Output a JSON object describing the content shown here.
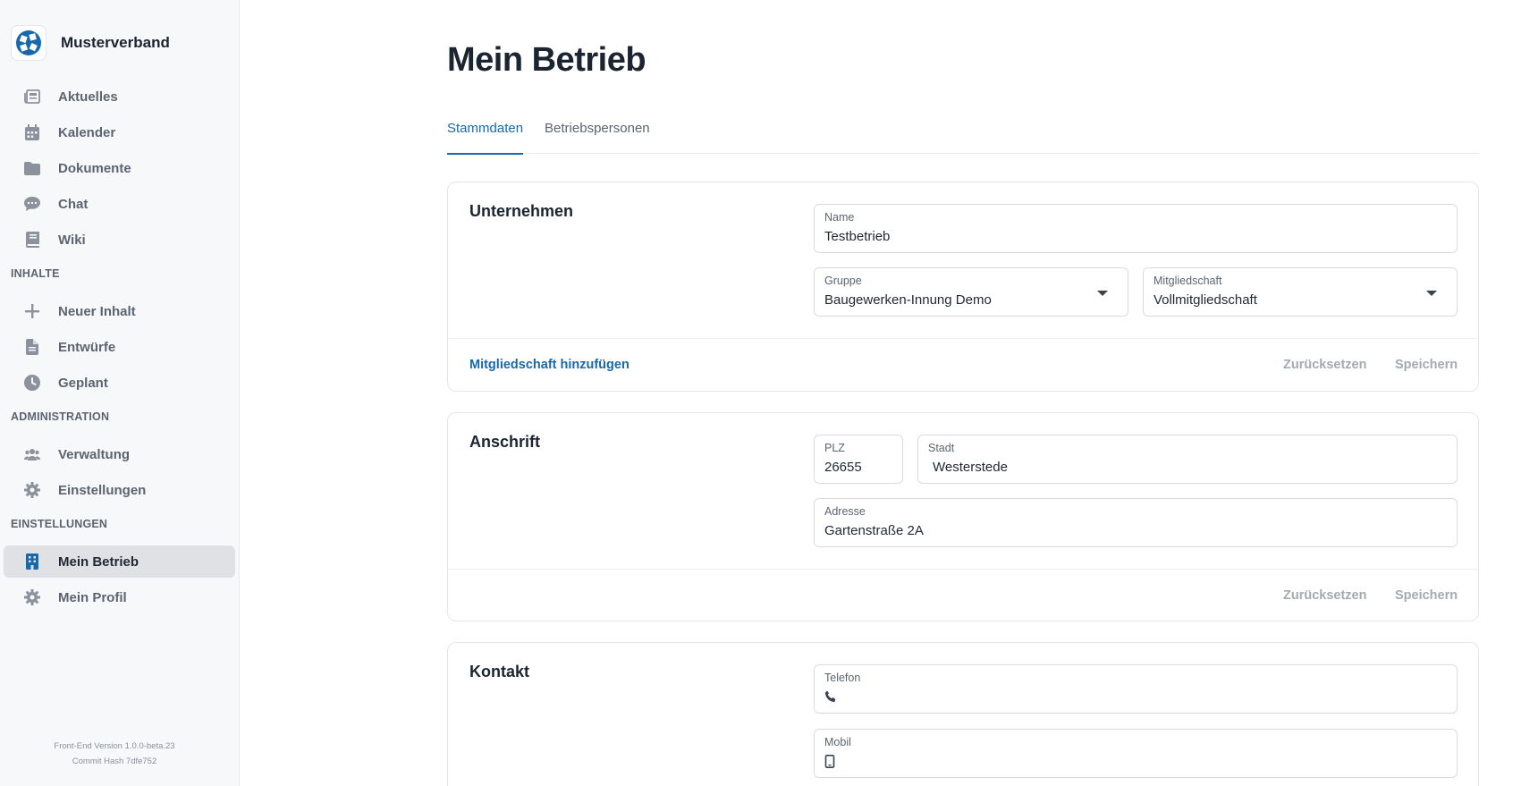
{
  "brand": {
    "name": "Musterverband"
  },
  "sidebar": {
    "main_items": [
      {
        "label": "Aktuelles",
        "icon": "newspaper-icon"
      },
      {
        "label": "Kalender",
        "icon": "calendar-icon"
      },
      {
        "label": "Dokumente",
        "icon": "folder-icon"
      },
      {
        "label": "Chat",
        "icon": "chat-icon"
      },
      {
        "label": "Wiki",
        "icon": "book-icon"
      }
    ],
    "sections": [
      {
        "title": "INHALTE",
        "items": [
          {
            "label": "Neuer Inhalt",
            "icon": "plus-icon"
          },
          {
            "label": "Entwürfe",
            "icon": "document-icon"
          },
          {
            "label": "Geplant",
            "icon": "clock-icon"
          }
        ]
      },
      {
        "title": "ADMINISTRATION",
        "items": [
          {
            "label": "Verwaltung",
            "icon": "people-icon"
          },
          {
            "label": "Einstellungen",
            "icon": "gear-icon"
          }
        ]
      },
      {
        "title": "EINSTELLUNGEN",
        "items": [
          {
            "label": "Mein Betrieb",
            "icon": "building-icon",
            "active": true
          },
          {
            "label": "Mein Profil",
            "icon": "gear-icon"
          }
        ]
      }
    ],
    "version_line": "Front-End Version 1.0.0-beta.23",
    "commit_line": "Commit Hash 7dfe752"
  },
  "page": {
    "title": "Mein Betrieb"
  },
  "tabs": [
    {
      "label": "Stammdaten",
      "active": true
    },
    {
      "label": "Betriebspersonen",
      "active": false
    }
  ],
  "unternehmen": {
    "title": "Unternehmen",
    "name": {
      "label": "Name",
      "value": "Testbetrieb"
    },
    "gruppe": {
      "label": "Gruppe",
      "value": "Baugewerken-Innung Demo"
    },
    "mitgliedschaft": {
      "label": "Mitgliedschaft",
      "value": "Vollmitgliedschaft"
    },
    "add_membership": "Mitgliedschaft hinzufügen",
    "reset": "Zurücksetzen",
    "save": "Speichern"
  },
  "anschrift": {
    "title": "Anschrift",
    "plz": {
      "label": "PLZ",
      "value": "26655"
    },
    "stadt": {
      "label": "Stadt",
      "value": "Westerstede"
    },
    "adresse": {
      "label": "Adresse",
      "value": "Gartenstraße 2A"
    },
    "reset": "Zurücksetzen",
    "save": "Speichern"
  },
  "kontakt": {
    "title": "Kontakt",
    "telefon": {
      "label": "Telefon",
      "value": ""
    },
    "mobil": {
      "label": "Mobil",
      "value": ""
    }
  },
  "colors": {
    "accent": "#1769aa",
    "sidebar_bg": "#f7f8fa",
    "active_bg": "#dfe1e5"
  }
}
